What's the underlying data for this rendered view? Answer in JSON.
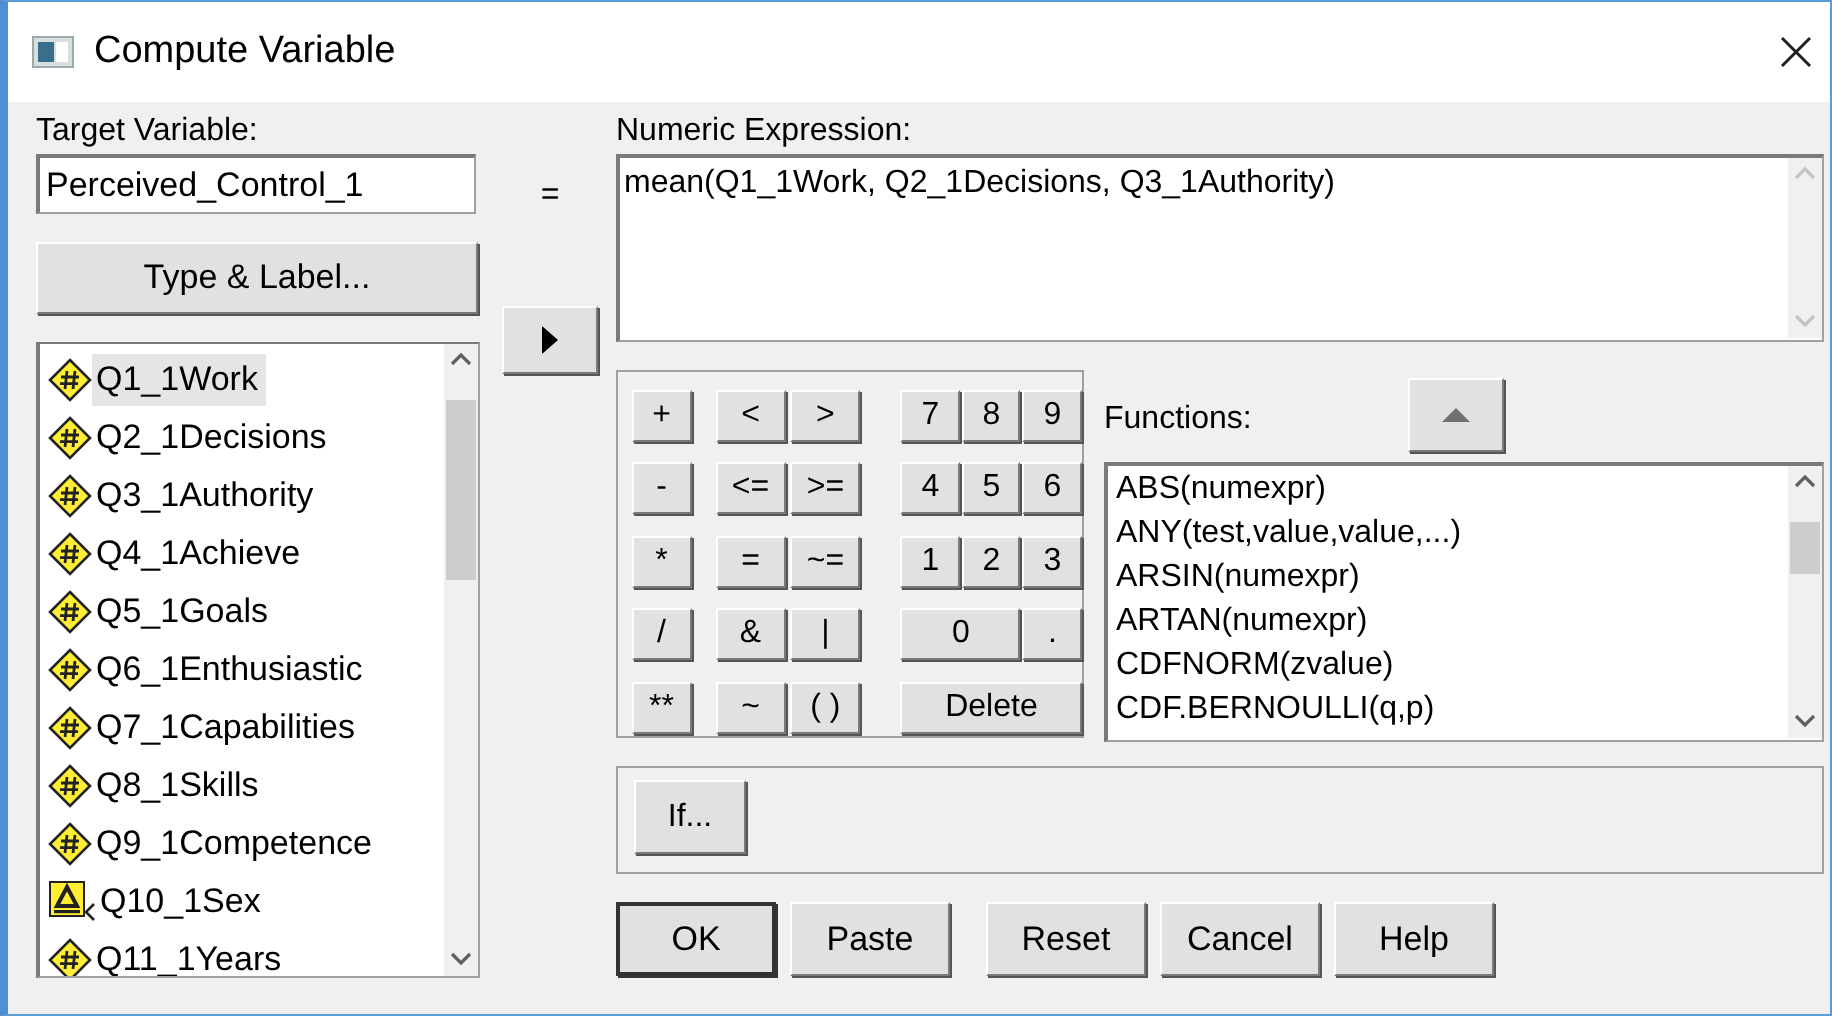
{
  "window": {
    "title": "Compute Variable"
  },
  "target_variable": {
    "label": "Target Variable:",
    "value": "Perceived_Control_1"
  },
  "type_label_button": "Type & Label...",
  "equals": "=",
  "variables": [
    {
      "name": "Q1_1Work",
      "kind": "numeric",
      "selected": true
    },
    {
      "name": "Q2_1Decisions",
      "kind": "numeric",
      "selected": false
    },
    {
      "name": "Q3_1Authority",
      "kind": "numeric",
      "selected": false
    },
    {
      "name": "Q4_1Achieve",
      "kind": "numeric",
      "selected": false
    },
    {
      "name": "Q5_1Goals",
      "kind": "numeric",
      "selected": false
    },
    {
      "name": "Q6_1Enthusiastic",
      "kind": "numeric",
      "selected": false
    },
    {
      "name": "Q7_1Capabilities",
      "kind": "numeric",
      "selected": false
    },
    {
      "name": "Q8_1Skills",
      "kind": "numeric",
      "selected": false
    },
    {
      "name": "Q9_1Competence",
      "kind": "numeric",
      "selected": false
    },
    {
      "name": "Q10_1Sex",
      "kind": "string",
      "selected": false
    },
    {
      "name": "Q11_1Years",
      "kind": "numeric",
      "selected": false
    }
  ],
  "numeric_expression": {
    "label": "Numeric Expression:",
    "value": "mean(Q1_1Work, Q2_1Decisions, Q3_1Authority)"
  },
  "keypad": [
    {
      "ops": [
        "+"
      ],
      "relations": [
        "<",
        ">"
      ],
      "digits": [
        "7",
        "8",
        "9"
      ]
    },
    {
      "ops": [
        "-"
      ],
      "relations": [
        "<=",
        ">="
      ],
      "digits": [
        "4",
        "5",
        "6"
      ]
    },
    {
      "ops": [
        "*"
      ],
      "relations": [
        "=",
        "~="
      ],
      "digits": [
        "1",
        "2",
        "3"
      ]
    },
    {
      "ops": [
        "/"
      ],
      "relations": [
        "&",
        "|"
      ],
      "digits": [
        "0",
        "."
      ]
    },
    {
      "ops": [
        "**"
      ],
      "relations": [
        "~",
        "( )"
      ],
      "digits": [
        "Delete"
      ]
    }
  ],
  "functions": {
    "label": "Functions:",
    "items": [
      "ABS(numexpr)",
      "ANY(test,value,value,...)",
      "ARSIN(numexpr)",
      "ARTAN(numexpr)",
      "CDFNORM(zvalue)",
      "CDF.BERNOULLI(q,p)"
    ]
  },
  "if_button": "If...",
  "buttons": [
    {
      "label": "OK",
      "default": true
    },
    {
      "label": "Paste",
      "default": false
    },
    {
      "label": "Reset",
      "default": false
    },
    {
      "label": "Cancel",
      "default": false
    },
    {
      "label": "Help",
      "default": false
    }
  ]
}
